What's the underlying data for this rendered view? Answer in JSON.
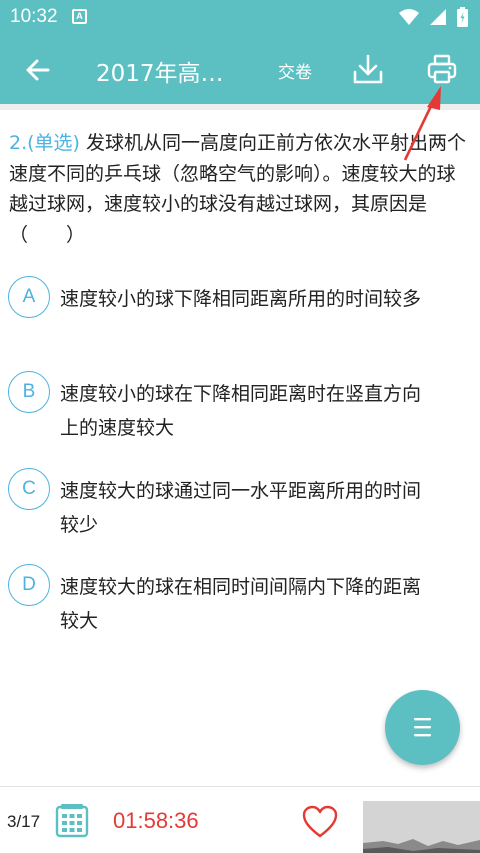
{
  "status_bar": {
    "time": "10:32",
    "notification_glyph": "A"
  },
  "app_bar": {
    "title": "2017年高…",
    "submit_label": "交卷"
  },
  "question": {
    "tag": "2.(单选)",
    "text": " 发球机从同一高度向正前方依次水平射出两个速度不同的乒乓球（忽略空气的影响）。速度较大的球越过球网，速度较小的球没有越过球网，其原因是（　　）"
  },
  "options": [
    {
      "letter": "A",
      "text": "速度较小的球下降相同距离所用的时间较多"
    },
    {
      "letter": "B",
      "text": "速度较小的球在下降相同距离时在竖直方向上的速度较大"
    },
    {
      "letter": "C",
      "text": "速度较大的球通过同一水平距离所用的时间较少"
    },
    {
      "letter": "D",
      "text": "速度较大的球在相同时间间隔内下降的距离较大"
    }
  ],
  "bottom_bar": {
    "progress": "3/17",
    "timer": "01:58:36"
  },
  "colors": {
    "primary": "#5cc0c3",
    "accent_blue": "#4db3e0",
    "timer_red": "#e53935",
    "annotation_arrow": "#e53935"
  },
  "icons": [
    "back-arrow-icon",
    "download-icon",
    "print-icon",
    "menu-icon",
    "grid-icon",
    "heart-icon"
  ]
}
